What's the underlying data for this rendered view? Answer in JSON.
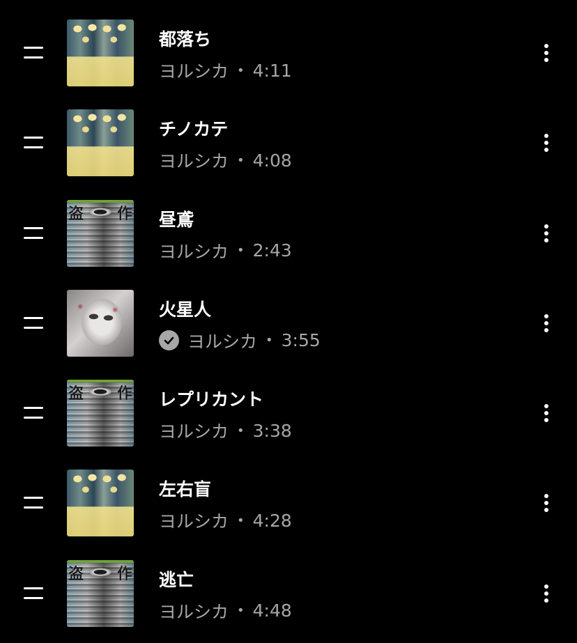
{
  "tracks": [
    {
      "title": "都落ち",
      "artist": "ヨルシカ",
      "separator": "•",
      "duration": "4:11",
      "art": "lantern-album-art",
      "downloaded": false
    },
    {
      "title": "チノカテ",
      "artist": "ヨルシカ",
      "separator": "•",
      "duration": "4:08",
      "art": "lantern-album-art",
      "downloaded": false
    },
    {
      "title": "昼鳶",
      "artist": "ヨルシカ",
      "separator": "•",
      "duration": "2:43",
      "art": "eye-collage-album-art",
      "downloaded": false
    },
    {
      "title": "火星人",
      "artist": "ヨルシカ",
      "separator": "•",
      "duration": "3:55",
      "art": "pale-face-album-art",
      "downloaded": true
    },
    {
      "title": "レプリカント",
      "artist": "ヨルシカ",
      "separator": "•",
      "duration": "3:38",
      "art": "eye-collage-album-art",
      "downloaded": false
    },
    {
      "title": "左右盲",
      "artist": "ヨルシカ",
      "separator": "•",
      "duration": "4:28",
      "art": "lantern-album-art",
      "downloaded": false
    },
    {
      "title": "逃亡",
      "artist": "ヨルシカ",
      "separator": "•",
      "duration": "4:48",
      "art": "eye-collage-album-art",
      "downloaded": false
    }
  ],
  "art_glyphs": {
    "top_left": "盗",
    "top_right": "作"
  },
  "colors": {
    "background": "#000000",
    "title": "#ffffff",
    "subtitle": "#a7a7a7",
    "icon": "#ffffff"
  },
  "icons": {
    "drag": "drag-handle-icon",
    "more": "more-vertical-icon",
    "downloaded": "downloaded-check-icon"
  }
}
